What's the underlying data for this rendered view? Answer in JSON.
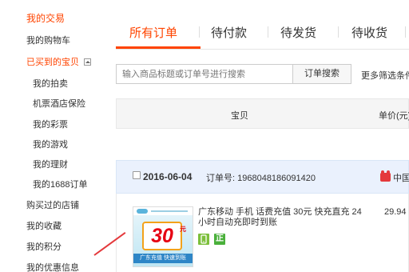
{
  "sidebar": {
    "my_trade": "我的交易",
    "cart": "我的购物车",
    "bought": "已买到的宝贝",
    "sub": [
      "我的拍卖",
      "机票酒店保险",
      "我的彩票",
      "我的游戏",
      "我的理财",
      "我的1688订单"
    ],
    "stores_bought": "购买过的店铺",
    "favorites": "我的收藏",
    "points": "我的积分",
    "coupons": "我的优惠信息"
  },
  "tabs": [
    "所有订单",
    "待付款",
    "待发货",
    "待收货"
  ],
  "search": {
    "placeholder": "输入商品标题或订单号进行搜索",
    "button": "订单搜索",
    "more": "更多筛选条件"
  },
  "table_header": {
    "item": "宝贝",
    "price": "单价(元)"
  },
  "order": {
    "date": "2016-06-04",
    "order_no": "订单号: 1968048186091420",
    "shop": "中国移动",
    "thumb_amount": "30",
    "thumb_unit": "元",
    "thumb_banner": "广东充值 快速到账",
    "title": "广东移动 手机 话费充值 30元 快充直充 24小时自动充即时到账",
    "badge_zheng": "正",
    "price": "29.94"
  },
  "colors": {
    "accent": "#ff4400",
    "order_head_bg": "#eaf1fd",
    "header_bg": "#f5f5f5"
  },
  "icons": {
    "collapse": "collapse-toggle-icon",
    "shop": "tmall-shop-icon",
    "phone": "phone-badge-icon"
  }
}
